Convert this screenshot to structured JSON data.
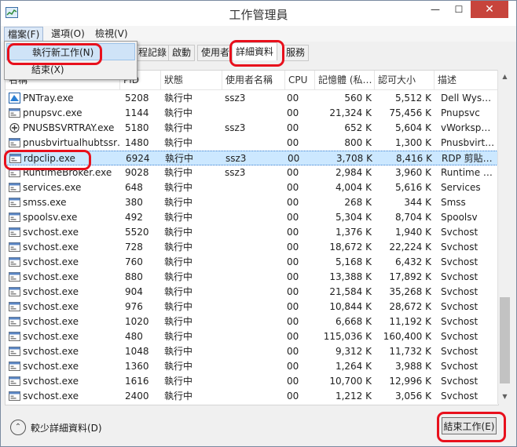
{
  "window": {
    "title": "工作管理員",
    "minimize": "—",
    "maximize": "☐",
    "close": "✕"
  },
  "menubar": {
    "file": "檔案(F)",
    "options": "選項(O)",
    "view": "檢視(V)"
  },
  "file_menu": {
    "new_task": "執行新工作(N)",
    "exit": "結束(X)"
  },
  "tabs": {
    "history": "程記錄",
    "startup": "啟動",
    "users": "使用者",
    "details": "詳細資料",
    "services": "服務"
  },
  "columns": {
    "name": "名稱",
    "pid": "PID",
    "status": "狀態",
    "user": "使用者名稱",
    "cpu": "CPU",
    "memory": "記憶體 (私…",
    "commit": "認可大小",
    "description": "描述",
    "sort_arrow": "^"
  },
  "processes": [
    {
      "name": "PNTray.exe",
      "pid": "5208",
      "status": "執行中",
      "user": "ssz3",
      "cpu": "00",
      "memory": "560 K",
      "commit": "5,512 K",
      "description": "Dell Wys…"
    },
    {
      "name": "pnupsvc.exe",
      "pid": "1144",
      "status": "執行中",
      "user": "",
      "cpu": "00",
      "memory": "21,324 K",
      "commit": "75,456 K",
      "description": "Pnupsvc"
    },
    {
      "name": "PNUSBSVRTRAY.exe",
      "pid": "5180",
      "status": "執行中",
      "user": "ssz3",
      "cpu": "00",
      "memory": "652 K",
      "commit": "5,604 K",
      "description": "vWorksp…"
    },
    {
      "name": "pnusbvirtualhubtssr…",
      "pid": "1480",
      "status": "執行中",
      "user": "",
      "cpu": "00",
      "memory": "800 K",
      "commit": "1,300 K",
      "description": "Pnusbvirt…"
    },
    {
      "name": "rdpclip.exe",
      "pid": "6924",
      "status": "執行中",
      "user": "ssz3",
      "cpu": "00",
      "memory": "3,708 K",
      "commit": "8,416 K",
      "description": "RDP 剪貼…"
    },
    {
      "name": "RuntimeBroker.exe",
      "pid": "9028",
      "status": "執行中",
      "user": "ssz3",
      "cpu": "00",
      "memory": "2,984 K",
      "commit": "3,960 K",
      "description": "Runtime …"
    },
    {
      "name": "services.exe",
      "pid": "648",
      "status": "執行中",
      "user": "",
      "cpu": "00",
      "memory": "4,004 K",
      "commit": "5,616 K",
      "description": "Services"
    },
    {
      "name": "smss.exe",
      "pid": "380",
      "status": "執行中",
      "user": "",
      "cpu": "00",
      "memory": "268 K",
      "commit": "344 K",
      "description": "Smss"
    },
    {
      "name": "spoolsv.exe",
      "pid": "492",
      "status": "執行中",
      "user": "",
      "cpu": "00",
      "memory": "5,304 K",
      "commit": "8,704 K",
      "description": "Spoolsv"
    },
    {
      "name": "svchost.exe",
      "pid": "5520",
      "status": "執行中",
      "user": "",
      "cpu": "00",
      "memory": "1,376 K",
      "commit": "1,940 K",
      "description": "Svchost"
    },
    {
      "name": "svchost.exe",
      "pid": "728",
      "status": "執行中",
      "user": "",
      "cpu": "00",
      "memory": "18,672 K",
      "commit": "22,224 K",
      "description": "Svchost"
    },
    {
      "name": "svchost.exe",
      "pid": "760",
      "status": "執行中",
      "user": "",
      "cpu": "00",
      "memory": "5,168 K",
      "commit": "6,432 K",
      "description": "Svchost"
    },
    {
      "name": "svchost.exe",
      "pid": "880",
      "status": "執行中",
      "user": "",
      "cpu": "00",
      "memory": "13,388 K",
      "commit": "17,892 K",
      "description": "Svchost"
    },
    {
      "name": "svchost.exe",
      "pid": "904",
      "status": "執行中",
      "user": "",
      "cpu": "00",
      "memory": "21,584 K",
      "commit": "35,268 K",
      "description": "Svchost"
    },
    {
      "name": "svchost.exe",
      "pid": "976",
      "status": "執行中",
      "user": "",
      "cpu": "00",
      "memory": "10,844 K",
      "commit": "28,672 K",
      "description": "Svchost"
    },
    {
      "name": "svchost.exe",
      "pid": "1020",
      "status": "執行中",
      "user": "",
      "cpu": "00",
      "memory": "6,668 K",
      "commit": "11,192 K",
      "description": "Svchost"
    },
    {
      "name": "svchost.exe",
      "pid": "480",
      "status": "執行中",
      "user": "",
      "cpu": "00",
      "memory": "115,036 K",
      "commit": "160,400 K",
      "description": "Svchost"
    },
    {
      "name": "svchost.exe",
      "pid": "1048",
      "status": "執行中",
      "user": "",
      "cpu": "00",
      "memory": "9,312 K",
      "commit": "11,732 K",
      "description": "Svchost"
    },
    {
      "name": "svchost.exe",
      "pid": "1360",
      "status": "執行中",
      "user": "",
      "cpu": "00",
      "memory": "1,264 K",
      "commit": "3,988 K",
      "description": "Svchost"
    },
    {
      "name": "svchost.exe",
      "pid": "1616",
      "status": "執行中",
      "user": "",
      "cpu": "00",
      "memory": "10,700 K",
      "commit": "12,996 K",
      "description": "Svchost"
    },
    {
      "name": "svchost.exe",
      "pid": "2400",
      "status": "執行中",
      "user": "",
      "cpu": "00",
      "memory": "1,212 K",
      "commit": "3,056 K",
      "description": "Svchost"
    }
  ],
  "selected_process": "rdpclip.exe",
  "footer": {
    "fewer_details": "較少詳細資料(D)",
    "end_task": "結束工作(E)"
  },
  "colors": {
    "highlight": "#e8101c",
    "selection": "#cce8ff",
    "close_button": "#c7443c"
  }
}
